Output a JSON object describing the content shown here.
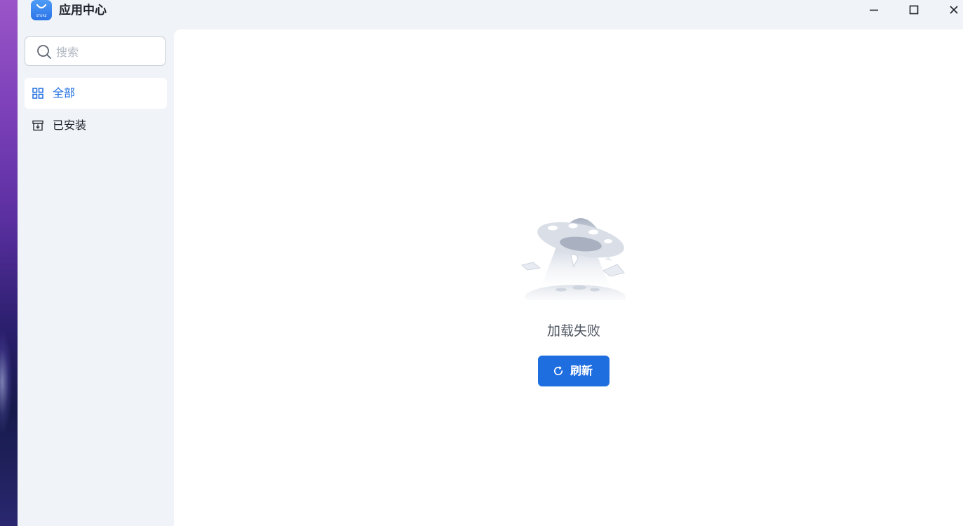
{
  "app": {
    "title": "应用中心",
    "icon": "store-bag-icon",
    "icon_text": "STORE",
    "accent_color": "#1f6ee0"
  },
  "window_controls": {
    "minimize": "minimize-icon",
    "maximize": "maximize-icon",
    "close": "close-icon"
  },
  "sidebar": {
    "search": {
      "placeholder": "搜索",
      "value": ""
    },
    "items": [
      {
        "label": "全部",
        "icon": "grid-icon",
        "active": true
      },
      {
        "label": "已安装",
        "icon": "installed-box-icon",
        "active": false
      }
    ]
  },
  "main": {
    "empty_state": {
      "illustration": "ufo-illustration",
      "message": "加载失败",
      "button_label": "刷新",
      "button_icon": "refresh-icon"
    }
  }
}
